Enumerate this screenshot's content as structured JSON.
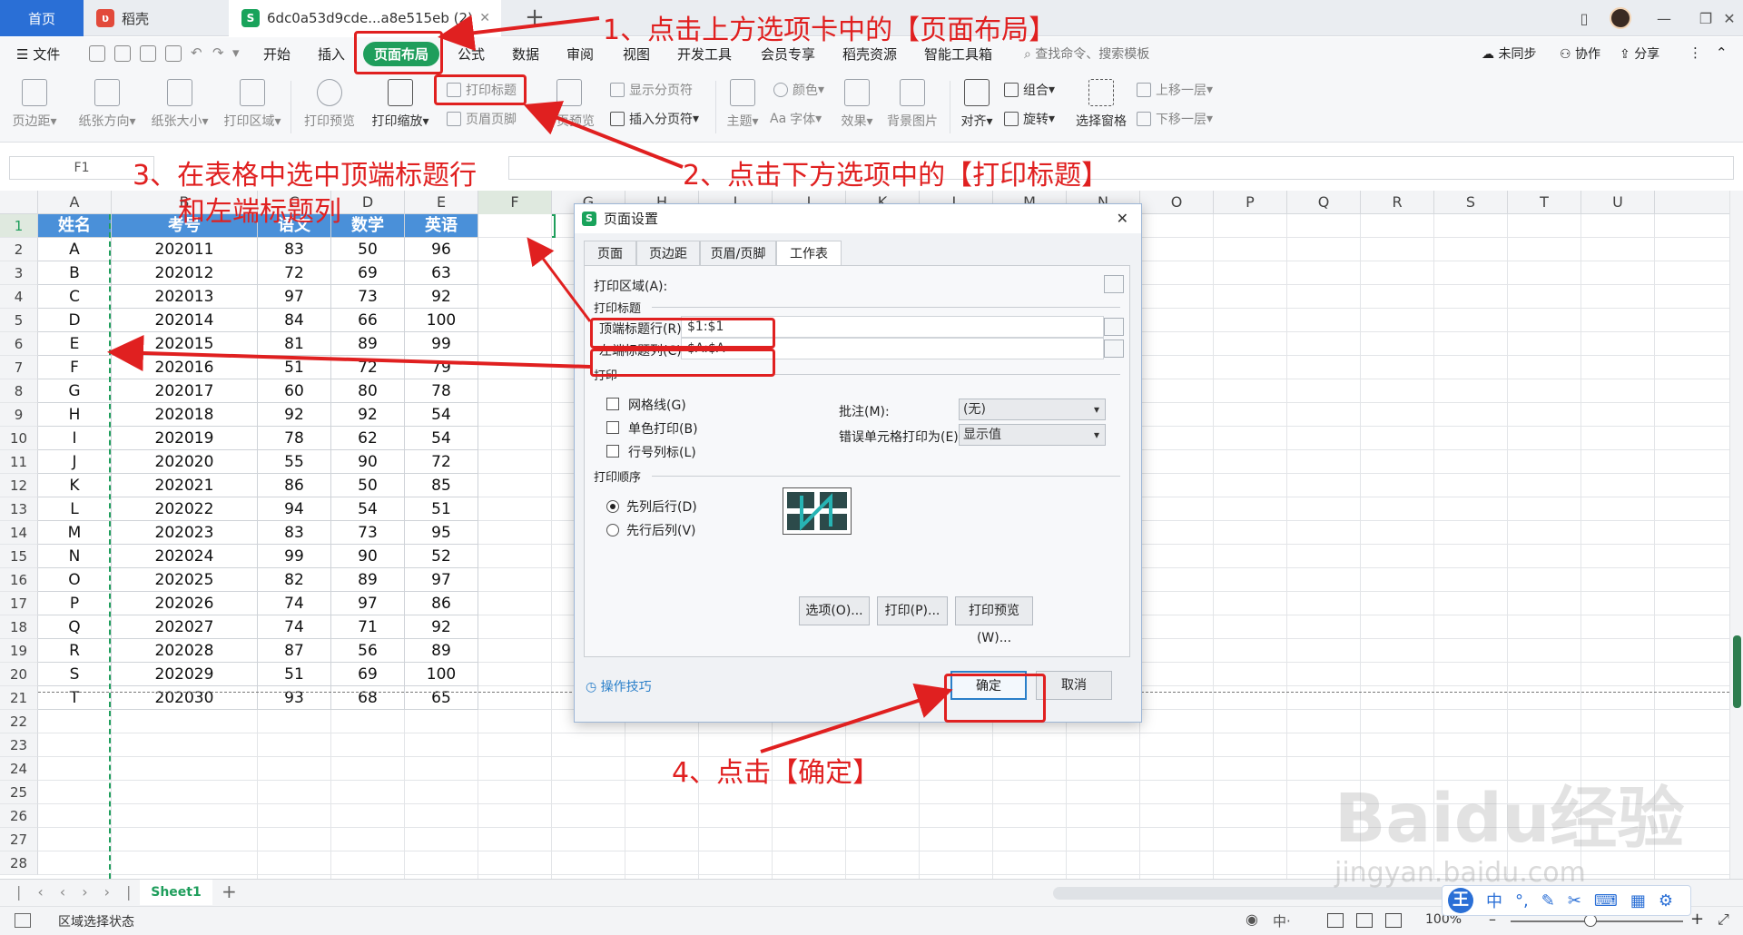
{
  "titlebar": {
    "home_tab": "首页",
    "daoke_tab": "稻壳",
    "doc_tab": "6dc0a53d9cde...a8e515eb (2)",
    "add_tab": "+"
  },
  "menu": {
    "file": "文件",
    "items": [
      "开始",
      "插入",
      "页面布局",
      "公式",
      "数据",
      "审阅",
      "视图",
      "开发工具",
      "会员专享",
      "稻壳资源",
      "智能工具箱"
    ],
    "search": "查找命令、搜索模板",
    "sync": "未同步",
    "collab": "协作",
    "share": "分享"
  },
  "ribbon": {
    "margin": "页边距",
    "orientation": "纸张方向",
    "size": "纸张大小",
    "print_area": "打印区域",
    "print_preview": "打印预览",
    "print_scale": "打印缩放",
    "print_title": "打印标题",
    "header_footer": "页眉页脚",
    "page_break_preview": "分页预览",
    "show_page_break": "显示分页符",
    "insert_page_break": "插入分页符",
    "theme": "主题",
    "color": "颜色",
    "font": "字体",
    "effect": "效果",
    "background": "背景图片",
    "align": "对齐",
    "group": "组合",
    "rotate": "旋转",
    "select_pane": "选择窗格",
    "bring_forward": "上移一层",
    "send_backward": "下移一层"
  },
  "formula_bar": {
    "name_box": "F1"
  },
  "sheet": {
    "columns": [
      "A",
      "B",
      "C",
      "D",
      "E",
      "F",
      "G",
      "H",
      "I",
      "J",
      "K",
      "L",
      "M",
      "N",
      "O",
      "P",
      "Q",
      "R",
      "S",
      "T",
      "U"
    ],
    "headers": [
      "姓名",
      "考号",
      "语文",
      "数学",
      "英语"
    ],
    "rows": [
      [
        "A",
        "202011",
        "83",
        "50",
        "96"
      ],
      [
        "B",
        "202012",
        "72",
        "69",
        "63"
      ],
      [
        "C",
        "202013",
        "97",
        "73",
        "92"
      ],
      [
        "D",
        "202014",
        "84",
        "66",
        "100"
      ],
      [
        "E",
        "202015",
        "81",
        "89",
        "99"
      ],
      [
        "F",
        "202016",
        "51",
        "72",
        "79"
      ],
      [
        "G",
        "202017",
        "60",
        "80",
        "78"
      ],
      [
        "H",
        "202018",
        "92",
        "92",
        "54"
      ],
      [
        "I",
        "202019",
        "78",
        "62",
        "54"
      ],
      [
        "J",
        "202020",
        "55",
        "90",
        "72"
      ],
      [
        "K",
        "202021",
        "86",
        "50",
        "85"
      ],
      [
        "L",
        "202022",
        "94",
        "54",
        "51"
      ],
      [
        "M",
        "202023",
        "83",
        "73",
        "95"
      ],
      [
        "N",
        "202024",
        "99",
        "90",
        "52"
      ],
      [
        "O",
        "202025",
        "82",
        "89",
        "97"
      ],
      [
        "P",
        "202026",
        "74",
        "97",
        "86"
      ],
      [
        "Q",
        "202027",
        "74",
        "71",
        "92"
      ],
      [
        "R",
        "202028",
        "87",
        "56",
        "89"
      ],
      [
        "S",
        "202029",
        "51",
        "69",
        "100"
      ],
      [
        "T",
        "202030",
        "93",
        "68",
        "65"
      ]
    ],
    "row_numbers": [
      "1",
      "2",
      "3",
      "4",
      "5",
      "6",
      "7",
      "8",
      "9",
      "10",
      "11",
      "12",
      "13",
      "14",
      "15",
      "16",
      "17",
      "18",
      "19",
      "20",
      "21",
      "22",
      "23",
      "24",
      "25",
      "26",
      "27",
      "28"
    ],
    "sheet_tab": "Sheet1"
  },
  "status": {
    "mode": "区域选择状态",
    "zoom": "100%"
  },
  "dialog": {
    "title": "页面设置",
    "tabs": [
      "页面",
      "页边距",
      "页眉/页脚",
      "工作表"
    ],
    "print_area_label": "打印区域(A):",
    "print_titles_group": "打印标题",
    "top_rows_label": "顶端标题行(R):",
    "top_rows_value": "$1:$1",
    "left_cols_label": "左端标题列(C):",
    "left_cols_value": "$A:$A",
    "print_group": "打印",
    "gridlines": "网格线(G)",
    "mono": "单色打印(B)",
    "row_col_headers": "行号列标(L)",
    "comments_label": "批注(M):",
    "comments_value": "(无)",
    "errors_label": "错误单元格打印为(E):",
    "errors_value": "显示值",
    "order_group": "打印顺序",
    "down_then_over": "先列后行(D)",
    "over_then_down": "先行后列(V)",
    "options_btn": "选项(O)...",
    "print_btn": "打印(P)...",
    "preview_btn": "打印预览(W)...",
    "tips": "操作技巧",
    "ok": "确定",
    "cancel": "取消"
  },
  "annotations": {
    "step1": "1、点击上方选项卡中的【页面布局】",
    "step2": "2、点击下方选项中的【打印标题】",
    "step3a": "3、在表格中选中顶端标题行",
    "step3b": "和左端标题列",
    "step4": "4、点击【确定】"
  },
  "ime": {
    "label": "中"
  },
  "watermark": {
    "brand": "Baidu经验",
    "url": "jingyan.baidu.com"
  },
  "colors": {
    "accent": "#1f9e5c",
    "header_fill": "#4a90d9",
    "annotation": "#e02020"
  }
}
